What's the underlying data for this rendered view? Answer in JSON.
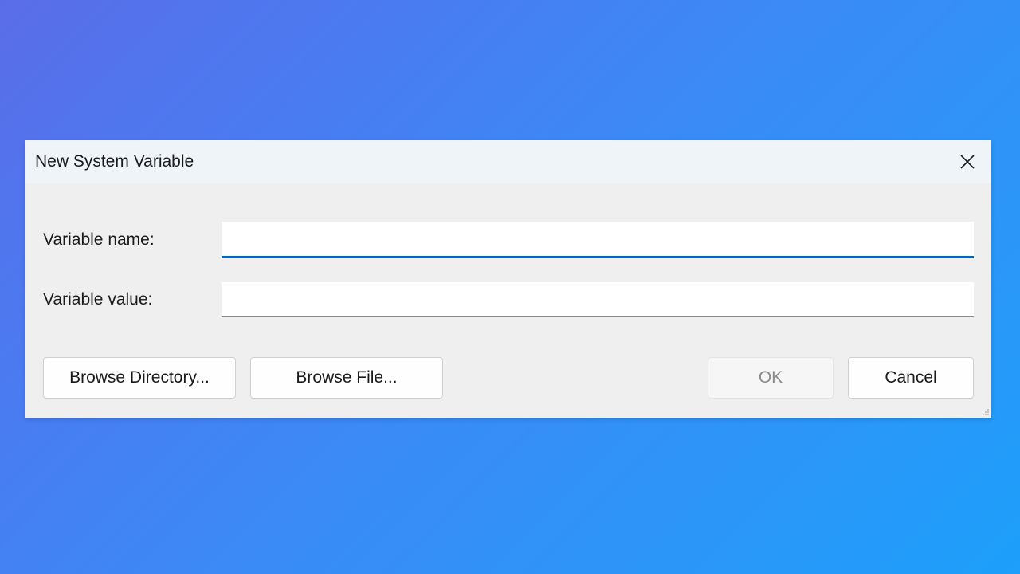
{
  "dialog": {
    "title": "New System Variable",
    "fields": {
      "name_label": "Variable name:",
      "name_value": "",
      "value_label": "Variable value:",
      "value_value": ""
    },
    "buttons": {
      "browse_directory": "Browse Directory...",
      "browse_file": "Browse File...",
      "ok": "OK",
      "cancel": "Cancel"
    }
  }
}
